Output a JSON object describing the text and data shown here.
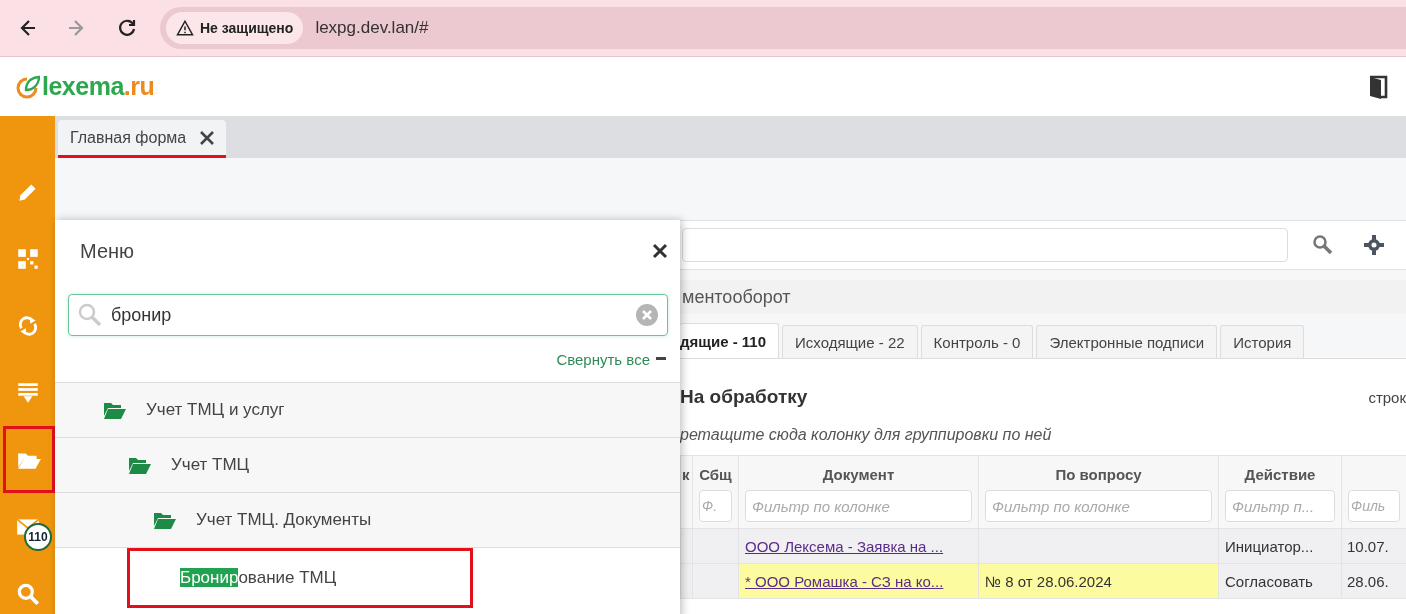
{
  "browser": {
    "nav_buttons": [
      {
        "disabled": false
      },
      {
        "disabled": true
      },
      {
        "disabled": false
      }
    ],
    "security_chip": "Не защищено",
    "url": "lexpg.dev.lan/#"
  },
  "header": {
    "logo": {
      "name": "lexema",
      "suffix": ".ru"
    }
  },
  "sidebar": {
    "items": [
      {
        "annotated": false
      },
      {
        "annotated": false
      },
      {
        "annotated": false
      },
      {
        "annotated": false
      },
      {
        "annotated": true
      },
      {
        "annotated": false,
        "badge": "110"
      },
      {
        "annotated": false
      }
    ]
  },
  "tabs": [
    {
      "label": "Главная форма",
      "annotated": true
    }
  ],
  "breadcrumb": "ментооборот",
  "doc_tabs": [
    {
      "label": "дящие - 110",
      "selected": true
    },
    {
      "label": "Исходящие - 22",
      "selected": false
    },
    {
      "label": "Контроль - 0",
      "selected": false
    },
    {
      "label": "Электронные подписи",
      "selected": false
    },
    {
      "label": "История",
      "selected": false
    }
  ],
  "panel": {
    "title": "На обработку",
    "rows_hint": "строк",
    "group_hint": "ретащите сюда колонку для группировки по ней"
  },
  "table": {
    "columns": [
      {
        "label": "к"
      },
      {
        "label": "Сбщ",
        "filter_placeholder": "Ф."
      },
      {
        "label": "Документ",
        "filter_placeholder": "Фильтр по колонке"
      },
      {
        "label": "По вопросу",
        "filter_placeholder": "Фильтр по колонке"
      },
      {
        "label": "Действие",
        "filter_placeholder": "Фильтр п..."
      },
      {
        "filter_placeholder": "Филь"
      }
    ],
    "rows": [
      {
        "highlighted": false,
        "document": "ООО Лексема - Заявка на ...",
        "action": "Инициатор...",
        "date": "10.07."
      },
      {
        "highlighted": true,
        "document": "* ООО Ромашка - СЗ на ко...",
        "question": "№ 8 от 28.06.2024",
        "action": "Согласовать",
        "date": "28.06."
      }
    ]
  },
  "menu": {
    "title": "Меню",
    "search": {
      "value": "бронир"
    },
    "collapse_all": "Свернуть все",
    "tree": [
      {
        "label": "Учет ТМЦ и услуг",
        "expanded": true,
        "children": [
          {
            "label": "Учет ТМЦ",
            "expanded": true,
            "children": [
              {
                "label": "Учет ТМЦ. Документы",
                "expanded": true,
                "children": [
                  {
                    "annotated": true,
                    "label_parts": [
                      {
                        "text": "Бронир",
                        "highlighted": true
                      },
                      {
                        "text": "ование ТМЦ",
                        "highlighted": false
                      }
                    ]
                  }
                ]
              }
            ]
          }
        ]
      }
    ]
  }
}
